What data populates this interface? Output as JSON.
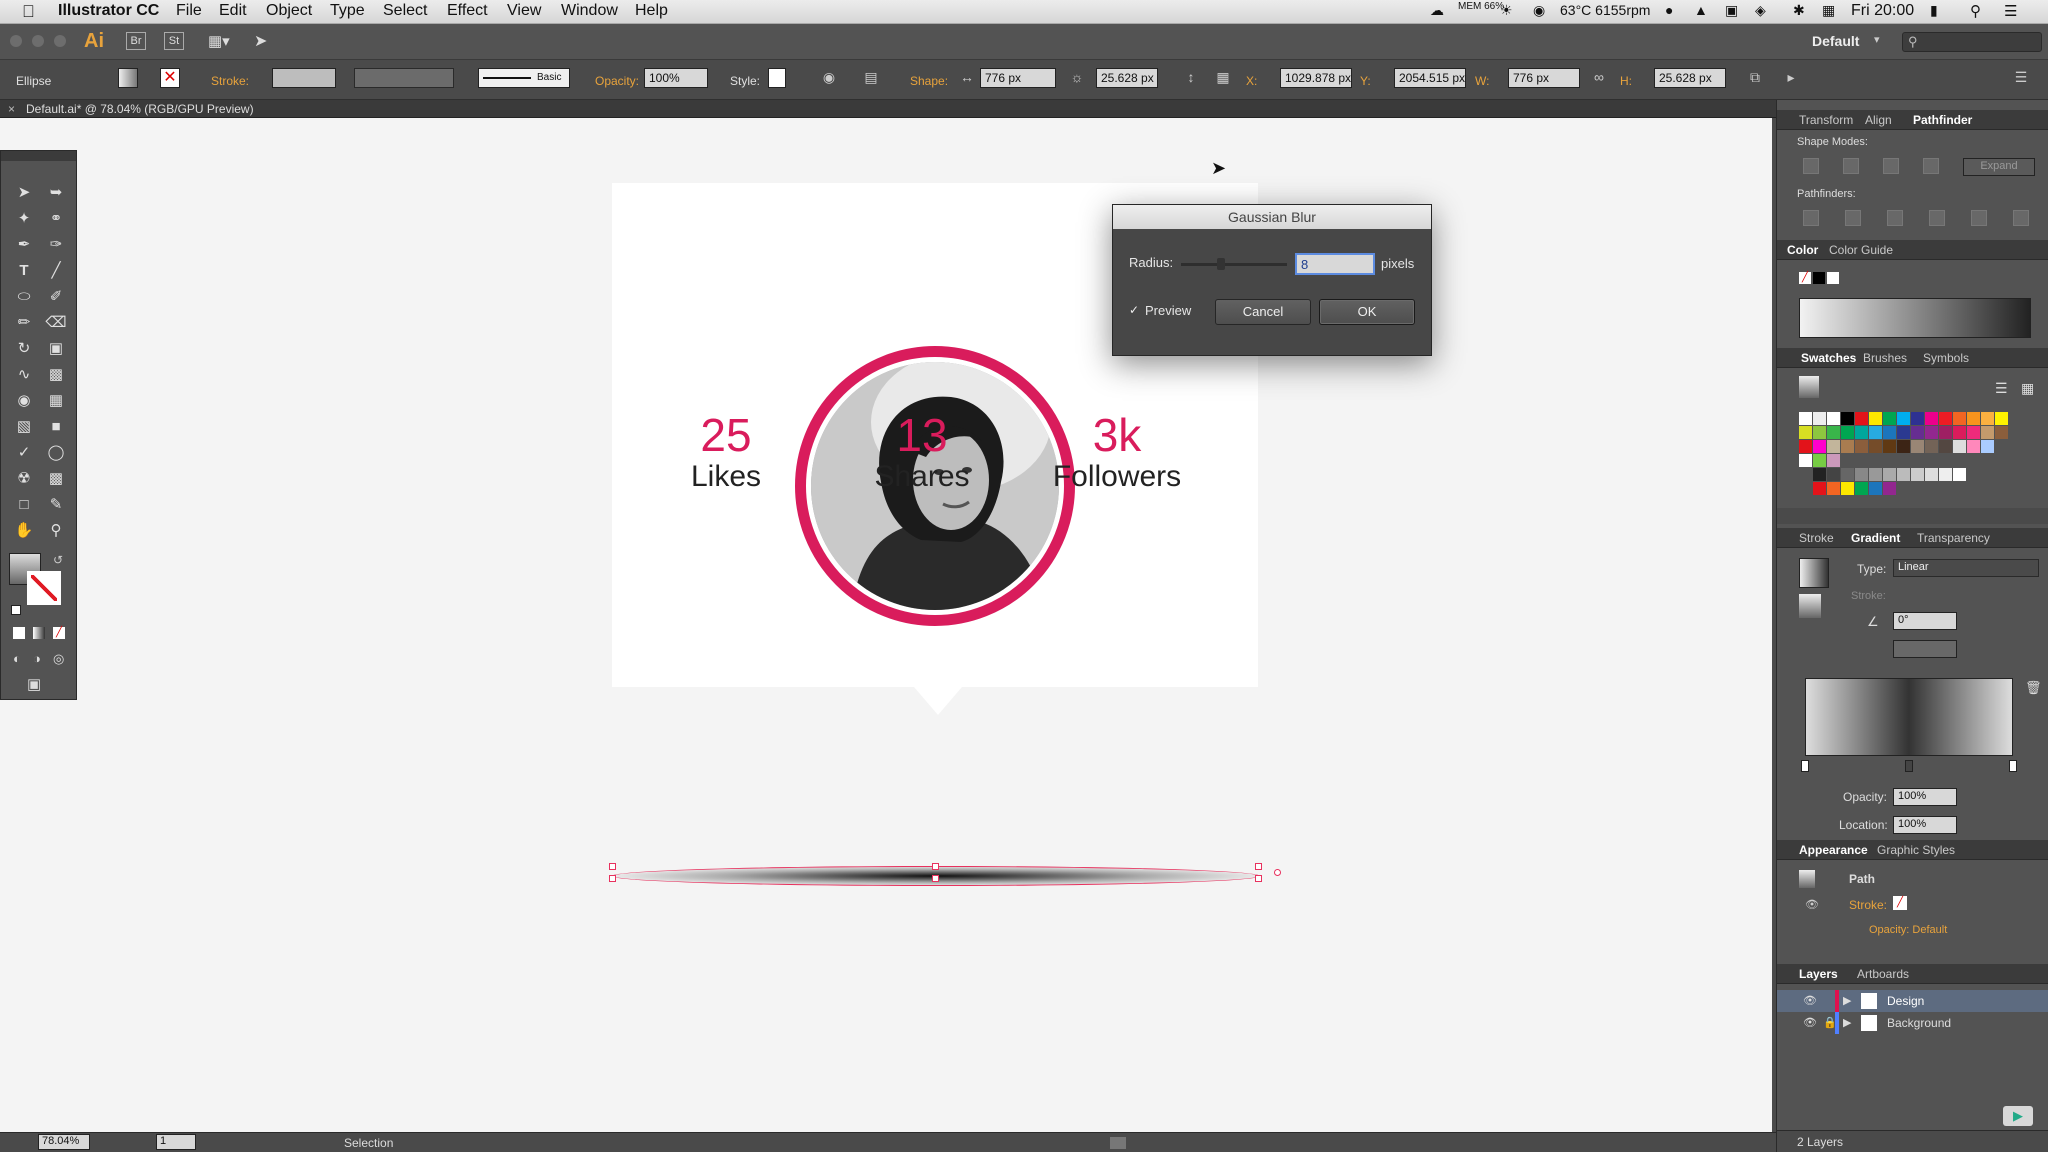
{
  "menubar": {
    "app_name": "Illustrator CC",
    "items": [
      "File",
      "Edit",
      "Object",
      "Type",
      "Select",
      "Effect",
      "View",
      "Window",
      "Help"
    ],
    "mem": "MEM 66%",
    "temp": "63°C 6155rpm",
    "clock": "Fri 20:00"
  },
  "appbar": {
    "ai_logo": "Ai",
    "br": "Br",
    "st": "St",
    "workspace": "Default",
    "search_placeholder": ""
  },
  "control_bar": {
    "selection_type": "Ellipse",
    "stroke_label": "Stroke:",
    "brush_label": "Basic",
    "opacity_label": "Opacity:",
    "opacity_value": "100%",
    "style_label": "Style:",
    "shape_label": "Shape:",
    "shape_w": "776 px",
    "shape_h": "25.628 px",
    "x_label": "X:",
    "x_value": "1029.878 px",
    "y_label": "Y:",
    "y_value": "2054.515 px",
    "w_label": "W:",
    "w_value": "776 px",
    "h_label": "H:",
    "h_value": "25.628 px"
  },
  "document_tab": {
    "title": "Default.ai* @ 78.04% (RGB/GPU Preview)"
  },
  "artboard": {
    "stats": [
      {
        "value": "25",
        "label": "Likes"
      },
      {
        "value": "13",
        "label": "Shares"
      },
      {
        "value": "3k",
        "label": "Followers"
      }
    ]
  },
  "dialog": {
    "title": "Gaussian Blur",
    "radius_label": "Radius:",
    "radius_value": "8",
    "unit": "pixels",
    "preview_label": "Preview",
    "cancel": "Cancel",
    "ok": "OK"
  },
  "panels": {
    "transform_tabs": [
      "Transform",
      "Align",
      "Pathfinder"
    ],
    "shape_modes": "Shape Modes:",
    "expand": "Expand",
    "pathfinders": "Pathfinders:",
    "color_tabs": [
      "Color",
      "Color Guide"
    ],
    "swatch_tabs": [
      "Swatches",
      "Brushes",
      "Symbols"
    ],
    "gradient_tabs": [
      "Stroke",
      "Gradient",
      "Transparency"
    ],
    "type_label": "Type:",
    "type_value": "Linear",
    "stroke_label": "Stroke:",
    "angle_value": "0°",
    "opacity_label": "Opacity:",
    "opacity_value": "100%",
    "location_label": "Location:",
    "location_value": "100%",
    "appearance_tabs": [
      "Appearance",
      "Graphic Styles"
    ],
    "path_label": "Path",
    "ap_stroke": "Stroke:",
    "ap_opacity": "Opacity: Default",
    "layers_tabs": [
      "Layers",
      "Artboards"
    ],
    "layers": [
      "Design",
      "Background"
    ],
    "layer_count": "2 Layers"
  },
  "status_bar": {
    "zoom": "78.04%",
    "page": "1",
    "tool": "Selection"
  },
  "colors": {
    "accent": "#d91c5c",
    "selection": "#e8315e"
  }
}
